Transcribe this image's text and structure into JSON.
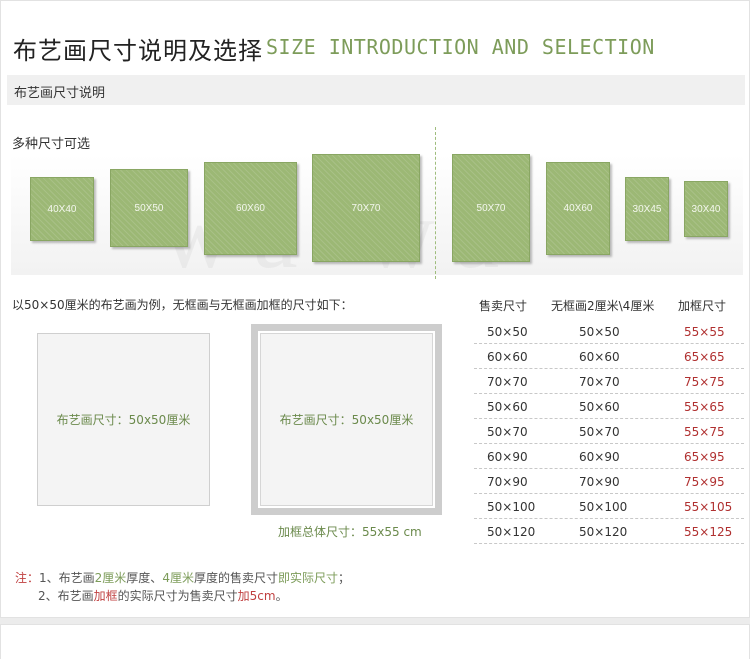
{
  "header": {
    "title_cn": "布艺画尺寸说明及选择",
    "title_en": "SIZE INTRODUCTION AND SELECTION"
  },
  "section_bar": {
    "label": "布艺画尺寸说明"
  },
  "sizes": {
    "label": "多种尺寸可选",
    "items": [
      "40X40",
      "50X50",
      "60X60",
      "70X70",
      "50X70",
      "40X60",
      "30X45",
      "30X40"
    ]
  },
  "example": {
    "text": "以50×50厘米的布艺画为例，无框画与无框画加框的尺寸如下：",
    "unframed_label": "布艺画尺寸：50x50厘米",
    "framed_label": "布艺画尺寸：50x50厘米",
    "framed_total": "加框总体尺寸：55x55 cm"
  },
  "table": {
    "headers": [
      "售卖尺寸",
      "无框画2厘米\\4厘米",
      "加框尺寸"
    ],
    "rows": [
      [
        "50×50",
        "50×50",
        "55×55"
      ],
      [
        "60×60",
        "60×60",
        "65×65"
      ],
      [
        "70×70",
        "70×70",
        "75×75"
      ],
      [
        "50×60",
        "50×60",
        "55×65"
      ],
      [
        "50×70",
        "50×70",
        "55×75"
      ],
      [
        "60×90",
        "60×90",
        "65×95"
      ],
      [
        "70×90",
        "70×90",
        "75×95"
      ],
      [
        "50×100",
        "50×100",
        "55×105"
      ],
      [
        "50×120",
        "50×120",
        "55×125"
      ]
    ]
  },
  "note": {
    "prefix": "注：",
    "line1": [
      "1、布艺画",
      "2厘米",
      "厚度、",
      "4厘米",
      "厚度的售卖尺寸",
      "即实际尺寸",
      "；"
    ],
    "line2": [
      "2、布艺画",
      "加框",
      "的实际尺寸为售卖尺寸",
      "加5cm",
      "。"
    ]
  },
  "colors": {
    "accent_green": "#7d9c5a",
    "canvas_green": "#9cb875",
    "price_red": "#b03030"
  }
}
